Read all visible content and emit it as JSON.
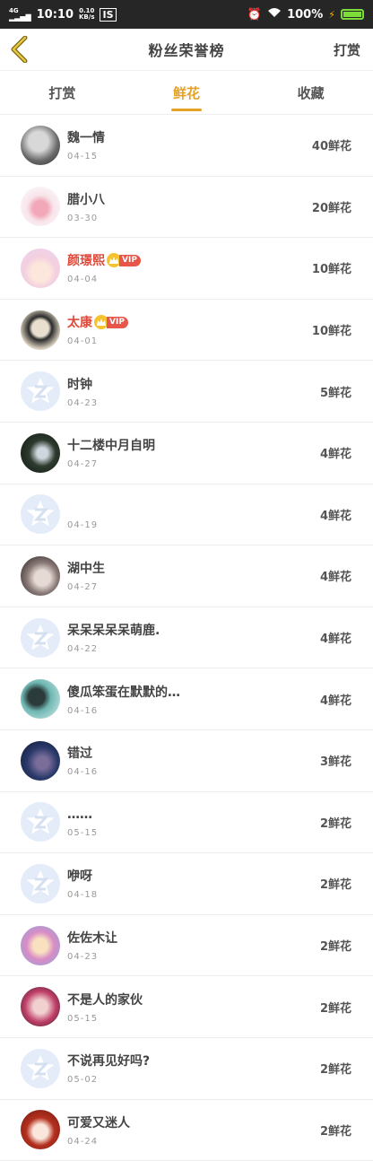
{
  "status_bar": {
    "network": "4G",
    "time": "10:10",
    "speed": "0.10\nKB/s",
    "battery": "100%"
  },
  "header": {
    "title": "粉丝荣誉榜",
    "action": "打赏"
  },
  "tabs": [
    {
      "label": "打赏",
      "active": false
    },
    {
      "label": "鲜花",
      "active": true
    },
    {
      "label": "收藏",
      "active": false
    }
  ],
  "accent_color": "#e3a126",
  "vip_label": "VIP",
  "rows": [
    {
      "name": "魏一情",
      "date": "04-15",
      "amount": "40鲜花",
      "avatar": "photo-gray",
      "vip": false
    },
    {
      "name": "腊小八",
      "date": "03-30",
      "amount": "20鲜花",
      "avatar": "photo-pink",
      "vip": false
    },
    {
      "name": "颜璟熙",
      "date": "04-04",
      "amount": "10鲜花",
      "avatar": "anime-girl",
      "vip": true
    },
    {
      "name": "太康",
      "date": "04-01",
      "amount": "10鲜花",
      "avatar": "ink-girl",
      "vip": true
    },
    {
      "name": "时钟",
      "date": "04-23",
      "amount": "5鲜花",
      "avatar": "default",
      "vip": false
    },
    {
      "name": "十二楼中月自明",
      "date": "04-27",
      "amount": "4鲜花",
      "avatar": "dark-girl",
      "vip": false
    },
    {
      "name": "",
      "date": "04-19",
      "amount": "4鲜花",
      "avatar": "default",
      "vip": false
    },
    {
      "name": "湖中生",
      "date": "04-27",
      "amount": "4鲜花",
      "avatar": "photo-dark",
      "vip": false
    },
    {
      "name": "呆呆呆呆呆萌鹿.",
      "date": "04-22",
      "amount": "4鲜花",
      "avatar": "default",
      "vip": false
    },
    {
      "name": "傻瓜笨蛋在默默的…",
      "date": "04-16",
      "amount": "4鲜花",
      "avatar": "teal-girl",
      "vip": false
    },
    {
      "name": "错过",
      "date": "04-16",
      "amount": "3鲜花",
      "avatar": "night-figure",
      "vip": false
    },
    {
      "name": "……",
      "date": "05-15",
      "amount": "2鲜花",
      "avatar": "default",
      "vip": false
    },
    {
      "name": "咿呀",
      "date": "04-18",
      "amount": "2鲜花",
      "avatar": "default",
      "vip": false
    },
    {
      "name": "佐佐木让",
      "date": "04-23",
      "amount": "2鲜花",
      "avatar": "anime-blonde",
      "vip": false
    },
    {
      "name": "不是人的家伙",
      "date": "05-15",
      "amount": "2鲜花",
      "avatar": "pink-girl",
      "vip": false
    },
    {
      "name": "不说再见好吗?",
      "date": "05-02",
      "amount": "2鲜花",
      "avatar": "default",
      "vip": false
    },
    {
      "name": "可爱又迷人",
      "date": "04-24",
      "amount": "2鲜花",
      "avatar": "anime-red",
      "vip": false
    }
  ]
}
